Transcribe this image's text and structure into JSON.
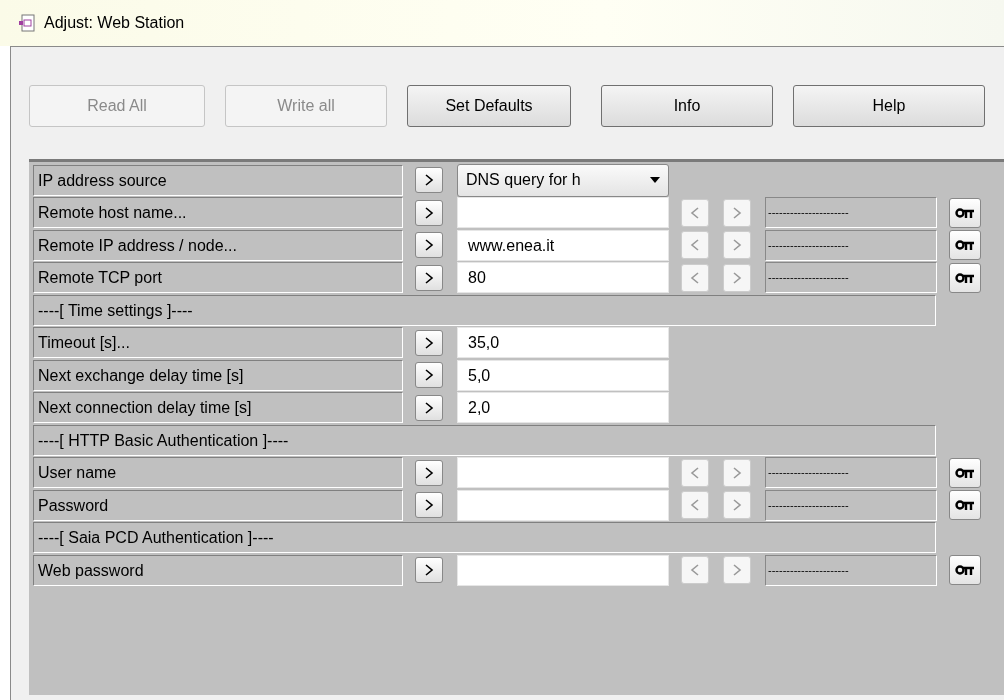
{
  "window": {
    "title": "Adjust: Web Station"
  },
  "buttons": [
    {
      "label": "Read All",
      "disabled": true
    },
    {
      "label": "Write all",
      "disabled": true
    },
    {
      "label": "Set Defaults",
      "disabled": false
    },
    {
      "label": "Info",
      "disabled": false
    },
    {
      "label": "Help",
      "disabled": false
    }
  ],
  "rows": [
    {
      "kind": "select",
      "label": "IP address source",
      "value": "DNS query for h"
    },
    {
      "kind": "param",
      "label": "Remote host name...",
      "value": "",
      "readout": "----------------------"
    },
    {
      "kind": "param",
      "label": "Remote IP address / node...",
      "value": "www.enea.it",
      "readout": "----------------------"
    },
    {
      "kind": "param",
      "label": "Remote TCP port",
      "value": "80",
      "readout": "----------------------"
    },
    {
      "kind": "section",
      "label": "----[ Time settings ]----"
    },
    {
      "kind": "plain",
      "label": "Timeout [s]...",
      "value": "35,0"
    },
    {
      "kind": "plain",
      "label": "Next exchange delay time [s]",
      "value": "5,0"
    },
    {
      "kind": "plain",
      "label": "Next connection delay time [s]",
      "value": "2,0"
    },
    {
      "kind": "section",
      "label": "----[ HTTP Basic Authentication ]----"
    },
    {
      "kind": "param",
      "label": "User name",
      "value": "",
      "readout": "----------------------"
    },
    {
      "kind": "param",
      "label": "Password",
      "value": "",
      "readout": "----------------------"
    },
    {
      "kind": "section",
      "label": "----[ Saia PCD Authentication ]----"
    },
    {
      "kind": "param",
      "label": "Web password",
      "value": "",
      "readout": "----------------------"
    }
  ]
}
